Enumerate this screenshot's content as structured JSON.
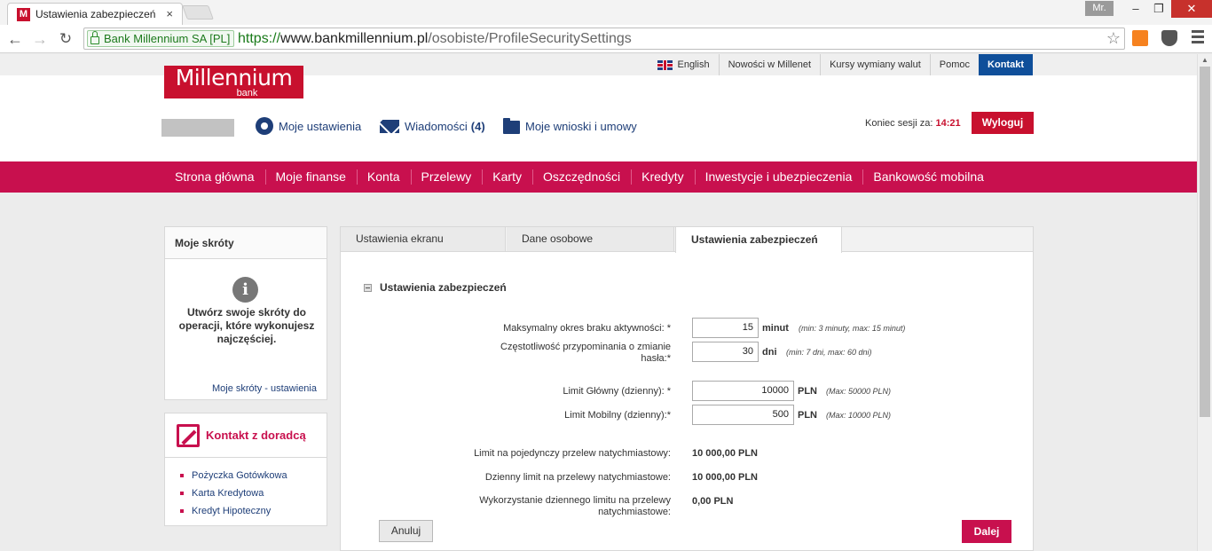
{
  "browser": {
    "tab_title": "Ustawienia zabezpieczeń",
    "tab_close": "×",
    "favicon": "M",
    "profile": "Mr.",
    "win_min": "–",
    "win_max": "❐",
    "win_close": "✕",
    "back": "←",
    "forward": "→",
    "reload": "↻",
    "ev_label": "Bank Millennium SA [PL]",
    "url_scheme": "https://",
    "url_host": "www.bankmillennium.pl",
    "url_path": "/osobiste/ProfileSecuritySettings",
    "star": "☆",
    "icons": [
      "back-icon",
      "forward-icon",
      "reload-icon",
      "lock-icon",
      "star-icon",
      "extension-icon",
      "pocket-icon",
      "menu-icon"
    ]
  },
  "topbar": {
    "links": [
      "English",
      "Nowości w Millenet",
      "Kursy wymiany walut",
      "Pomoc",
      "Kontakt"
    ]
  },
  "logo": {
    "name": "Millennium",
    "sub": "bank"
  },
  "header": {
    "settings": "Moje ustawienia",
    "messages": "Wiadomości",
    "messages_count": "(4)",
    "requests": "Moje wnioski i umowy",
    "session_label": "Koniec sesji za:",
    "session_time": "14:21",
    "logout": "Wyloguj"
  },
  "mainnav": [
    "Strona główna",
    "Moje finanse",
    "Konta",
    "Przelewy",
    "Karty",
    "Oszczędności",
    "Kredyty",
    "Inwestycje i ubezpieczenia",
    "Bankowość mobilna"
  ],
  "sidebar": {
    "shortcuts_title": "Moje skróty",
    "info_glyph": "i",
    "shortcuts_text": "Utwórz swoje skróty do operacji, które wykonujesz najczęściej.",
    "shortcuts_link": "Moje skróty - ustawienia",
    "advisor_title": "Kontakt z doradcą",
    "advisor_items": [
      "Pożyczka Gotówkowa",
      "Karta Kredytowa",
      "Kredyt Hipoteczny"
    ]
  },
  "tabs": [
    "Ustawienia ekranu",
    "Dane osobowe",
    "Ustawienia zabezpieczeń"
  ],
  "form": {
    "section_title": "Ustawienia zabezpieczeń",
    "inactivity_label": "Maksymalny okres braku aktywności: *",
    "inactivity_value": "15",
    "inactivity_unit": "minut",
    "inactivity_hint": "(min: 3 minuty, max: 15 minut)",
    "password_label": "Częstotliwość przypominania o zmianie hasła:*",
    "password_value": "30",
    "password_unit": "dni",
    "password_hint": "(min: 7 dni, max: 60 dni)",
    "main_limit_label": "Limit Główny (dzienny): *",
    "main_limit_value": "10000",
    "main_limit_unit": "PLN",
    "main_limit_hint": "(Max: 50000 PLN)",
    "mobile_limit_label": "Limit Mobilny (dzienny):*",
    "mobile_limit_value": "500",
    "mobile_limit_unit": "PLN",
    "mobile_limit_hint": "(Max: 10000 PLN)",
    "single_instant_label": "Limit na pojedynczy przelew natychmiastowy:",
    "single_instant_value": "10 000,00 PLN",
    "daily_instant_label": "Dzienny limit na przelewy natychmiastowe:",
    "daily_instant_value": "10 000,00 PLN",
    "usage_label": "Wykorzystanie dziennego limitu na przelewy natychmiastowe:",
    "usage_value": "0,00 PLN",
    "cancel": "Anuluj",
    "next": "Dalej"
  }
}
